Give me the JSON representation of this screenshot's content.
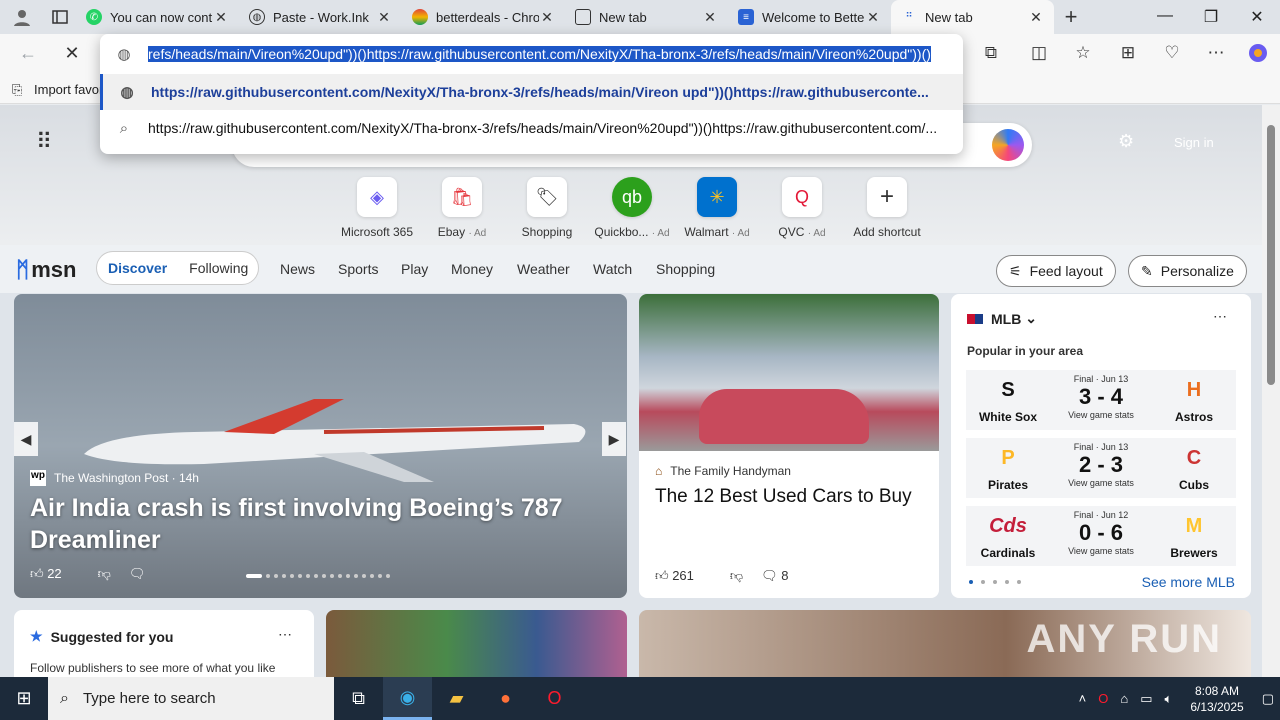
{
  "browser": {
    "tabs": [
      {
        "title": "You can now conti",
        "icon": "whatsapp-icon",
        "color": "#25d366",
        "active": false
      },
      {
        "title": "Paste - Work.Ink",
        "icon": "globe-icon",
        "color": "#555555",
        "active": false
      },
      {
        "title": "betterdeals - Chro",
        "icon": "chrome-store-icon",
        "color": "#e0463a",
        "active": false
      },
      {
        "title": "New tab",
        "icon": "newtab-icon",
        "color": "#333333",
        "active": false
      },
      {
        "title": "Welcome to Better",
        "icon": "edge-addon-icon",
        "color": "#2a63d4",
        "active": false
      },
      {
        "title": "New tab",
        "icon": "loading-icon",
        "color": "#2a63d4",
        "active": true
      }
    ],
    "address_selected": "refs/heads/main/Vireon%20upd\"))()https://raw.githubusercontent.com/NexityX/Tha-bronx-3/refs/heads/main/Vireon%20upd\"))()",
    "suggestion_1": "https://raw.githubusercontent.com/NexityX/Tha-bronx-3/refs/heads/main/Vireon upd\"))()https://raw.githubuserconte...",
    "suggestion_2": "https://raw.githubusercontent.com/NexityX/Tha-bronx-3/refs/heads/main/Vireon%20upd\"))()https://raw.githubusercontent.com/...",
    "favorites_bar_label": "Import favor"
  },
  "newtab": {
    "signin": "Sign in",
    "shortcuts": [
      {
        "label": "Microsoft 365",
        "ad": "",
        "icon": "microsoft365-icon"
      },
      {
        "label": "Ebay",
        "ad": "· Ad",
        "icon": "ebay-icon"
      },
      {
        "label": "Shopping",
        "ad": "",
        "icon": "shopping-tag-icon"
      },
      {
        "label": "Quickbo...",
        "ad": "· Ad",
        "icon": "quickbooks-icon"
      },
      {
        "label": "Walmart",
        "ad": "· Ad",
        "icon": "walmart-icon"
      },
      {
        "label": "QVC",
        "ad": "· Ad",
        "icon": "qvc-icon"
      },
      {
        "label": "Add shortcut",
        "ad": "",
        "icon": "plus-icon"
      }
    ]
  },
  "feed": {
    "logo": "msn",
    "pills": [
      "Discover",
      "Following"
    ],
    "nav": [
      "News",
      "Sports",
      "Play",
      "Money",
      "Weather",
      "Watch",
      "Shopping"
    ],
    "feed_layout": "Feed layout",
    "personalize": "Personalize"
  },
  "hero": {
    "source": "The Washington Post",
    "age": "14h",
    "title": "Air India crash is first involving Boeing’s 787 Dreamliner",
    "likes": "22"
  },
  "article": {
    "source": "The Family Handyman",
    "title": "The 12 Best Used Cars to Buy",
    "likes": "261",
    "comments": "8"
  },
  "mlb": {
    "league": "MLB",
    "subtitle": "Popular in your area",
    "games": [
      {
        "status": "Final · Jun 13",
        "score": "3 - 4",
        "link": "View game stats",
        "home": "White Sox",
        "away": "Astros",
        "home_color": "#111111",
        "away_color": "#002d62"
      },
      {
        "status": "Final · Jun 13",
        "score": "2 - 3",
        "link": "View game stats",
        "home": "Pirates",
        "away": "Cubs",
        "home_color": "#111111",
        "away_color": "#0e3386"
      },
      {
        "status": "Final · Jun 12",
        "score": "0 - 6",
        "link": "View game stats",
        "home": "Cardinals",
        "away": "Brewers",
        "home_color": "#c41e3a",
        "away_color": "#12284b"
      }
    ],
    "see_more": "See more MLB"
  },
  "suggested": {
    "title": "Suggested for you",
    "text": "Follow publishers to see more of what you like"
  },
  "watermark": "ANY RUN",
  "taskbar": {
    "search_placeholder": "Type here to search",
    "time": "8:08 AM",
    "date": "6/13/2025"
  }
}
